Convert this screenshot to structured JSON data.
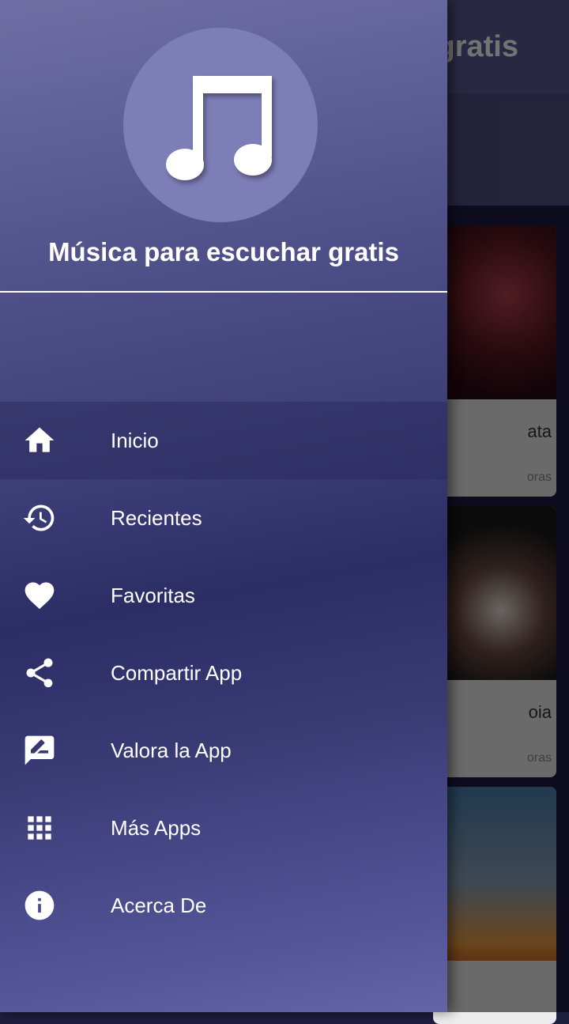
{
  "background_app": {
    "title": "gratis",
    "cards": [
      {
        "title": "ata",
        "subtitle": "oras"
      },
      {
        "title": "oia",
        "subtitle": "oras"
      },
      {
        "title": "",
        "subtitle": ""
      }
    ]
  },
  "drawer": {
    "header": {
      "logo_icon": "music-note-icon",
      "title": "Música para escuchar gratis"
    },
    "items": [
      {
        "label": "Inicio",
        "icon": "home-icon",
        "selected": true
      },
      {
        "label": "Recientes",
        "icon": "history-icon",
        "selected": false
      },
      {
        "label": "Favoritas",
        "icon": "heart-icon",
        "selected": false
      },
      {
        "label": "Compartir App",
        "icon": "share-icon",
        "selected": false
      },
      {
        "label": "Valora la App",
        "icon": "rate-review-icon",
        "selected": false
      },
      {
        "label": "Más Apps",
        "icon": "apps-grid-icon",
        "selected": false
      },
      {
        "label": "Acerca De",
        "icon": "info-icon",
        "selected": false
      }
    ]
  },
  "colors": {
    "drawer_top": "#6f6fa6",
    "drawer_mid": "#2c2d65",
    "logo_circle": "#7d7db7",
    "app_bar": "#5a5a92",
    "text": "#ffffff"
  }
}
